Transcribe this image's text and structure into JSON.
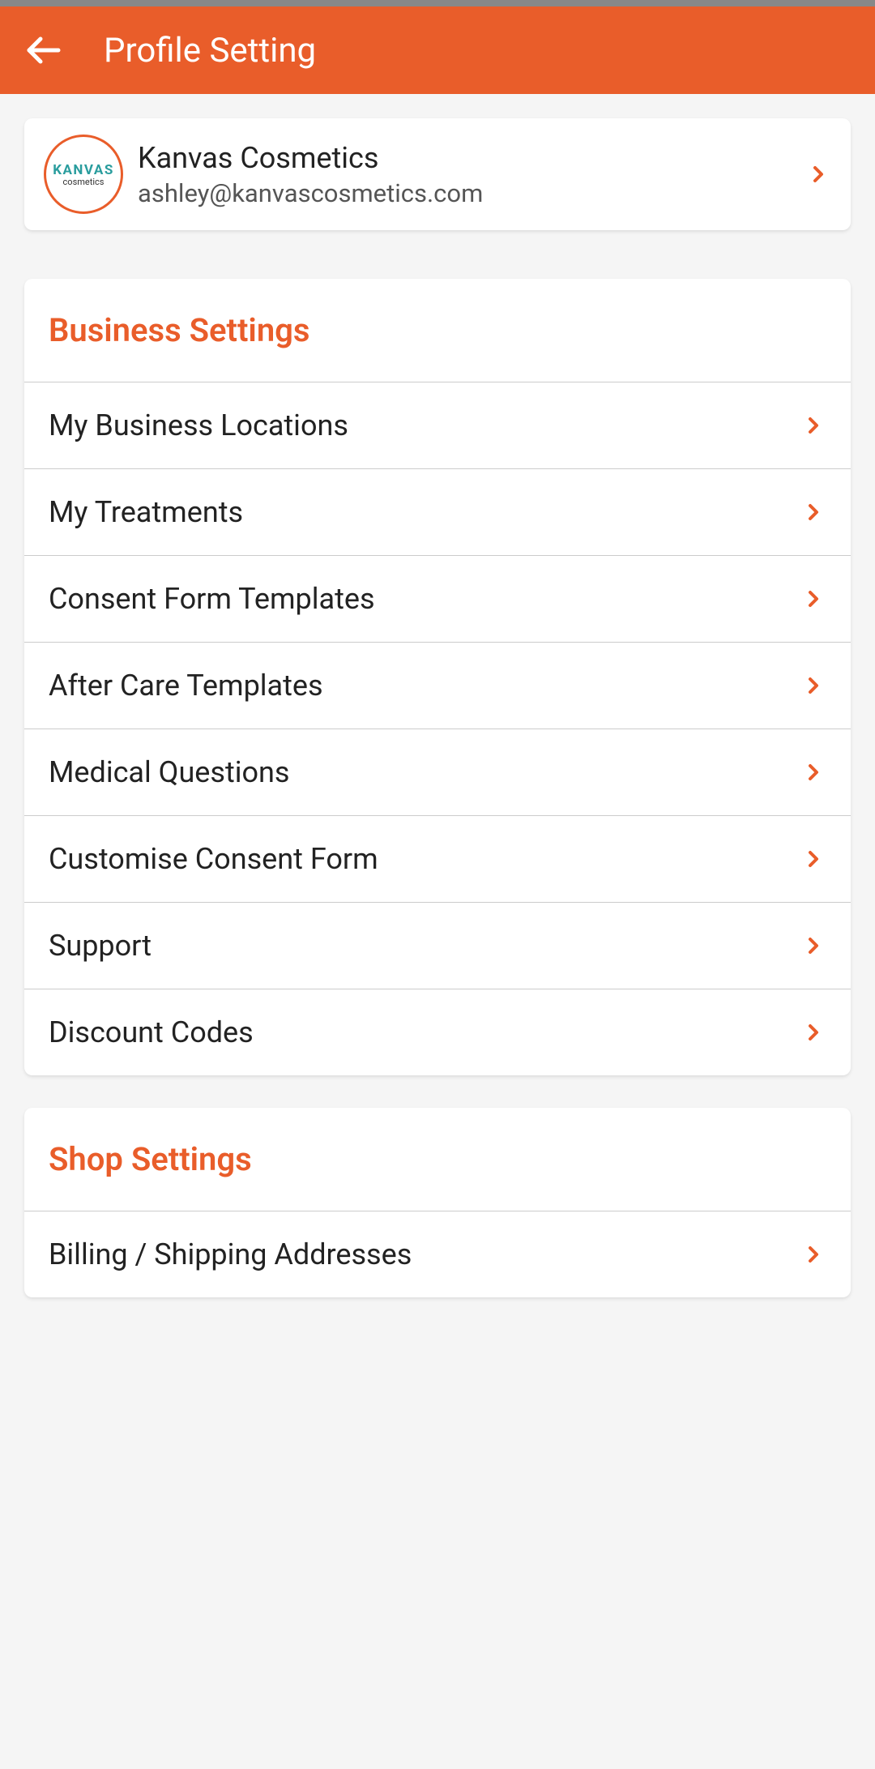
{
  "header": {
    "title": "Profile Setting"
  },
  "profile": {
    "name": "Kanvas Cosmetics",
    "email": "ashley@kanvascosmetics.com",
    "logo_text_main": "KANVAS",
    "logo_text_sub": "cosmetics"
  },
  "sections": [
    {
      "title": "Business Settings",
      "items": [
        {
          "label": "My Business Locations"
        },
        {
          "label": "My Treatments"
        },
        {
          "label": "Consent Form Templates"
        },
        {
          "label": "After Care Templates"
        },
        {
          "label": "Medical Questions"
        },
        {
          "label": "Customise Consent Form"
        },
        {
          "label": "Support"
        },
        {
          "label": "Discount Codes"
        }
      ]
    },
    {
      "title": "Shop Settings",
      "items": [
        {
          "label": "Billing / Shipping Addresses"
        }
      ]
    }
  ]
}
